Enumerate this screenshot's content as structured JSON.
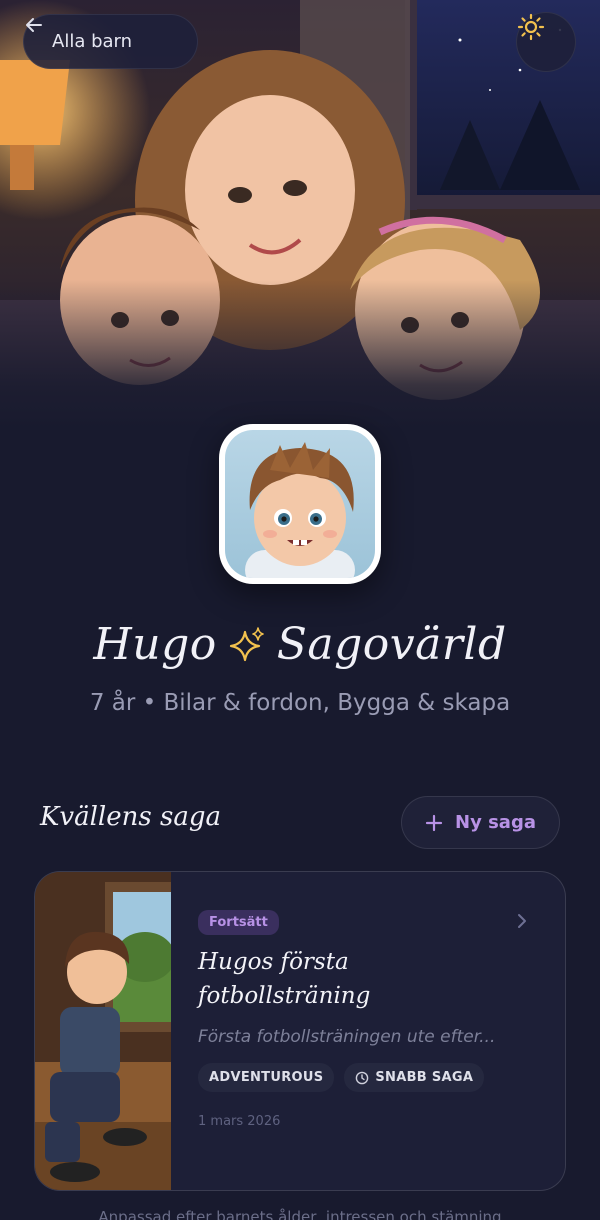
{
  "header": {
    "back_label": "Alla barn",
    "back_icon": "arrow-left-icon",
    "theme_icon": "sun-icon",
    "accent": "#f2c14e"
  },
  "profile": {
    "name": "Hugo",
    "title_icon": "sparkles-icon",
    "world_label": "Sagovärld",
    "subtitle": "7 år • Bilar & fordon, Bygga & skapa"
  },
  "section": {
    "title": "Kvällens saga",
    "new_story_label": "Ny saga",
    "new_story_icon": "plus-icon"
  },
  "story": {
    "badge": "Fortsätt",
    "title": "Hugos första fotbollsträning",
    "description": "Första fotbollsträningen ute efter...",
    "tags": [
      "ADVENTUROUS",
      "SNABB SAGA"
    ],
    "date": "1 mars 2026",
    "chevron_icon": "chevron-right-icon"
  },
  "footer_note": "Anpassad efter barnets ålder, intressen och stämning",
  "colors": {
    "background": "#181a2e",
    "card": "#1d1f37",
    "accent_purple": "#b892e6",
    "muted_text": "#9a9cb4"
  }
}
